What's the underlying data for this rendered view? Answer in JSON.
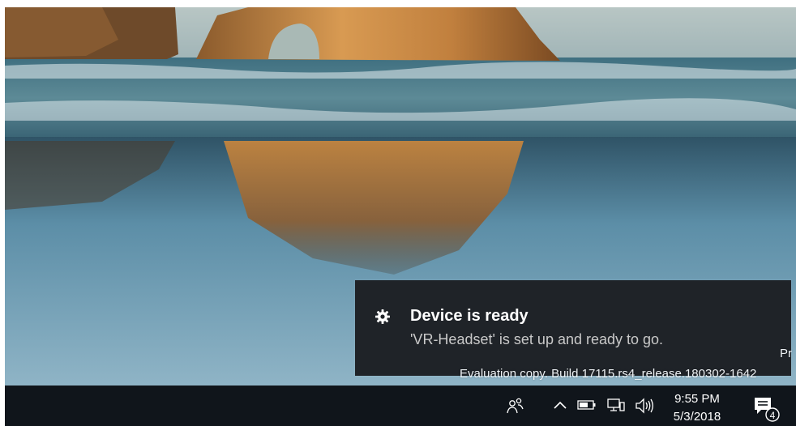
{
  "notification": {
    "icon": "gear-icon",
    "title": "Device is ready",
    "body": "'VR-Headset' is set up and ready to go."
  },
  "watermark": {
    "line1": "Pr",
    "line2": "Evaluation copy. Build 17115.rs4_release.180302-1642"
  },
  "taskbar": {
    "tray_icons": [
      "people-icon",
      "chevron-up-icon",
      "battery-icon",
      "network-icon",
      "volume-icon"
    ],
    "time": "9:55 PM",
    "date": "5/3/2018",
    "notification_count": "4"
  },
  "colors": {
    "toast_bg": "#1f2328",
    "taskbar_bg": "#10151b",
    "toast_title": "#ffffff",
    "toast_body": "#c9c9c9"
  }
}
